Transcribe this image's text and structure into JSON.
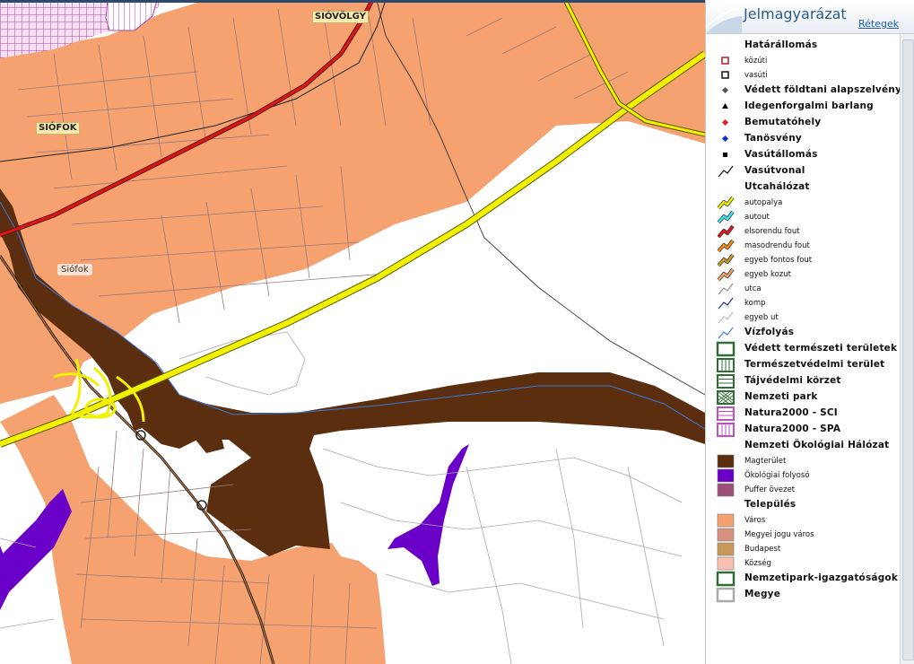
{
  "map": {
    "labels": {
      "siovolgy": "SIÓVÖLGY",
      "siofok_station": "SIÓFOK",
      "siofok_town": "Siófok"
    }
  },
  "legend": {
    "title": "Jelmagyarázat",
    "back_link": "Rétegek",
    "items": [
      {
        "label": "Határállomás",
        "size": "big",
        "icon": "none"
      },
      {
        "label": "közúti",
        "size": "small",
        "icon": "border-crossing-road"
      },
      {
        "label": "vasúti",
        "size": "small",
        "icon": "border-crossing-rail"
      },
      {
        "label": "Védett földtani alapszelvény",
        "size": "big",
        "icon": "diamond",
        "color": "#555555"
      },
      {
        "label": "Idegenforgalmi barlang",
        "size": "big",
        "icon": "triangle",
        "color": "#000000"
      },
      {
        "label": "Bemutatóhely",
        "size": "big",
        "icon": "diamond",
        "color": "#e02020"
      },
      {
        "label": "Tanösvény",
        "size": "big",
        "icon": "diamond",
        "color": "#1030d0"
      },
      {
        "label": "Vasútállomás",
        "size": "big",
        "icon": "square",
        "color": "#000000"
      },
      {
        "label": "Vasútvonal",
        "size": "big",
        "icon": "line",
        "color": "#000000"
      },
      {
        "label": "Utcahálózat",
        "size": "big",
        "icon": "none"
      },
      {
        "label": "autopalya",
        "size": "small",
        "icon": "road",
        "color": "#f2f200"
      },
      {
        "label": "autout",
        "size": "small",
        "icon": "road",
        "color": "#40e0f0"
      },
      {
        "label": "elsorendu fout",
        "size": "small",
        "icon": "road",
        "color": "#d81818"
      },
      {
        "label": "masodrendu fout",
        "size": "small",
        "icon": "road",
        "color": "#f08a10"
      },
      {
        "label": "egyeb fontos fout",
        "size": "small",
        "icon": "road",
        "color": "#c89828"
      },
      {
        "label": "egyeb kozut",
        "size": "small",
        "icon": "road",
        "color": "#f0a060"
      },
      {
        "label": "utca",
        "size": "small",
        "icon": "line",
        "color": "#888888"
      },
      {
        "label": "komp",
        "size": "small",
        "icon": "line",
        "color": "#1a2a90"
      },
      {
        "label": "egyeb ut",
        "size": "small",
        "icon": "line",
        "color": "#bbbbbb"
      },
      {
        "label": "Vízfolyás",
        "size": "big",
        "icon": "line",
        "color": "#3a7ad8"
      },
      {
        "label": "Védett természeti területek",
        "size": "big",
        "icon": "box",
        "color": "#2f6f35"
      },
      {
        "label": "Természetvédelmi terület",
        "size": "big",
        "icon": "box-vlines",
        "color": "#2f6f35"
      },
      {
        "label": "Tájvédelmi körzet",
        "size": "big",
        "icon": "box-hlines",
        "color": "#2f6f35"
      },
      {
        "label": "Nemzeti park",
        "size": "big",
        "icon": "box-cross",
        "color": "#2f6f35"
      },
      {
        "label": "Natura2000 - SCI",
        "size": "big",
        "icon": "box-hlines",
        "color": "#c050c0"
      },
      {
        "label": "Natura2000 - SPA",
        "size": "big",
        "icon": "box-vlines",
        "color": "#c050c0"
      },
      {
        "label": "Nemzeti Ökológiai Hálózat",
        "size": "big",
        "icon": "none"
      },
      {
        "label": "Magterület",
        "size": "small",
        "icon": "fill",
        "color": "#5a2e0e"
      },
      {
        "label": "Ökológiai folyosó",
        "size": "small",
        "icon": "fill",
        "color": "#6a00c8"
      },
      {
        "label": "Puffer övezet",
        "size": "small",
        "icon": "fill",
        "color": "#9a5078"
      },
      {
        "label": "Település",
        "size": "big",
        "icon": "none"
      },
      {
        "label": "Város",
        "size": "small",
        "icon": "fill",
        "color": "#f4a070"
      },
      {
        "label": "Megyei jogu város",
        "size": "small",
        "icon": "fill",
        "color": "#d89080"
      },
      {
        "label": "Budapest",
        "size": "small",
        "icon": "fill",
        "color": "#c89858"
      },
      {
        "label": "Község",
        "size": "small",
        "icon": "fill",
        "color": "#f8c0b0"
      },
      {
        "label": "Nemzetipark-igazgatóságok",
        "size": "big",
        "icon": "box",
        "color": "#2f6f35"
      },
      {
        "label": "Megye",
        "size": "big",
        "icon": "box",
        "color": "#aaaaaa"
      }
    ]
  }
}
